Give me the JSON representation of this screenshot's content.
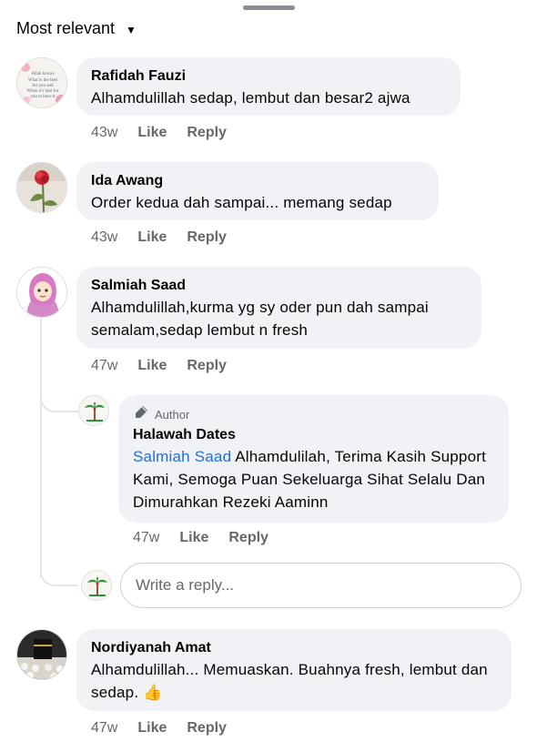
{
  "sort": {
    "label": "Most relevant",
    "icon": "chevron-down-icon"
  },
  "actions": {
    "like": "Like",
    "reply": "Reply"
  },
  "comments": [
    {
      "name": "Rafidah Fauzi",
      "text": "Alhamdulillah sedap, lembut dan besar2 ajwa",
      "time": "43w",
      "avatar_text": [
        "Allah knows",
        "What is the best",
        "for you and",
        "When it's best for",
        "you to have it"
      ]
    },
    {
      "name": "Ida Awang",
      "text": "Order kedua dah sampai... memang sedap",
      "time": "43w"
    },
    {
      "name": "Salmiah Saad",
      "text": "Alhamdulillah,kurma yg sy oder pun dah sampai semalam,sedap lembut n fresh",
      "time": "47w",
      "reply": {
        "author_badge": "Author",
        "name": "Halawah Dates",
        "mention": "Salmiah Saad",
        "text": " Alhamdulilah, Terima Kasih Support Kami, Semoga Puan Sekeluarga Sihat Selalu Dan Dimurahkan Rezeki Aaminn",
        "time": "47w"
      }
    },
    {
      "name": "Nordiyanah Amat",
      "text": "Alhamdulillah... Memuaskan. Buahnya fresh, lembut dan sedap.",
      "emoji": "👍",
      "time": "47w"
    }
  ],
  "reply_input": {
    "placeholder": "Write a reply..."
  }
}
